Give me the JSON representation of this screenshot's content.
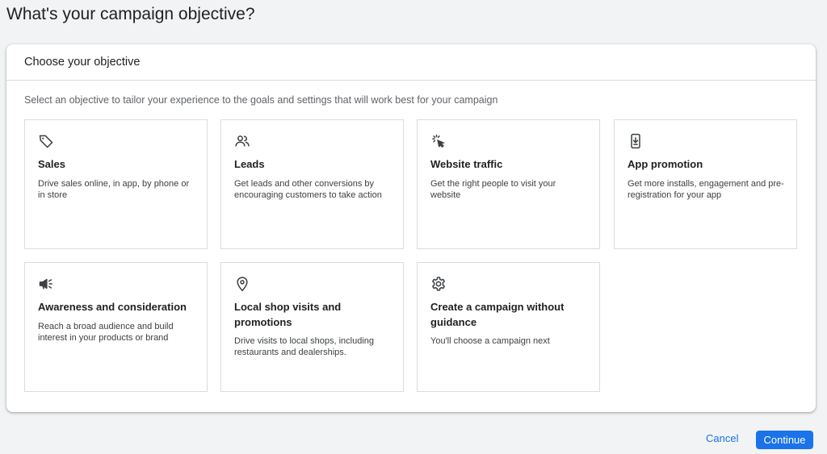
{
  "page": {
    "title": "What's your campaign objective?"
  },
  "panel": {
    "header": "Choose your objective",
    "description": "Select an objective to tailor your experience to the goals and settings that will work best for your campaign"
  },
  "objectives": [
    {
      "icon": "tag-icon",
      "title": "Sales",
      "description": "Drive sales online, in app, by phone or in store"
    },
    {
      "icon": "people-icon",
      "title": "Leads",
      "description": "Get leads and other conversions by encouraging customers to take action"
    },
    {
      "icon": "cursor-click-icon",
      "title": "Website traffic",
      "description": "Get the right people to visit your website"
    },
    {
      "icon": "phone-download-icon",
      "title": "App promotion",
      "description": "Get more installs, engagement and pre-registration for your app"
    },
    {
      "icon": "megaphone-icon",
      "title": "Awareness and consideration",
      "description": "Reach a broad audience and build interest in your products or brand"
    },
    {
      "icon": "map-pin-icon",
      "title": "Local shop visits and promotions",
      "description": "Drive visits to local shops, including restaurants and dealerships."
    },
    {
      "icon": "gear-icon",
      "title": "Create a campaign without guidance",
      "description": "You'll choose a campaign next"
    }
  ],
  "footer": {
    "cancel_label": "Cancel",
    "continue_label": "Continue"
  },
  "colors": {
    "accent": "#1a73e8",
    "background": "#f1f3f4",
    "border": "#dadce0"
  }
}
